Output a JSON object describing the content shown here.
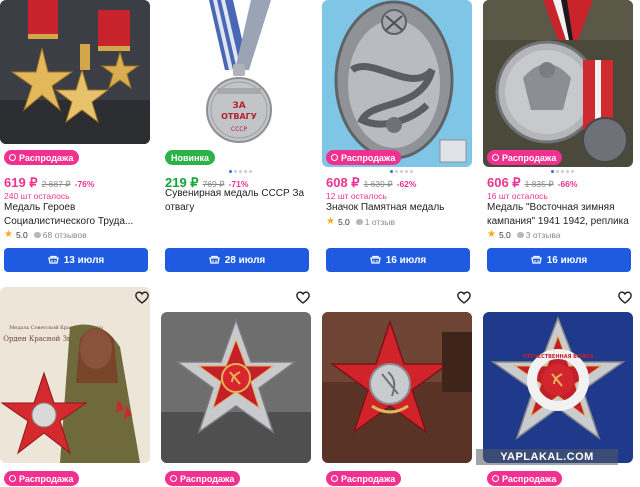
{
  "products": [
    {
      "badge": "Распродажа",
      "badge_type": "sale",
      "price": "619 ₽",
      "old_price": "2 687 ₽",
      "discount": "-76%",
      "stock": "240 шт осталось",
      "title": "Медаль Героев Социалистического Труда...",
      "rating": "5.0",
      "reviews": "68 отзывов",
      "delivery": "13 июля"
    },
    {
      "badge": "Новинка",
      "badge_type": "new",
      "price": "219 ₽",
      "old_price": "769 ₽",
      "discount": "-71%",
      "stock": "",
      "title": "Сувенирная медаль СССР За отвагу",
      "rating": "",
      "reviews": "",
      "delivery": "28 июля"
    },
    {
      "badge": "Распродажа",
      "badge_type": "sale",
      "price": "608 ₽",
      "old_price": "1 639 ₽",
      "discount": "-62%",
      "stock": "12 шт осталось",
      "title": "Значок Памятная медаль",
      "rating": "5.0",
      "reviews": "1 отзыв",
      "delivery": "16 июля"
    },
    {
      "badge": "Распродажа",
      "badge_type": "sale",
      "price": "606 ₽",
      "old_price": "1 835 ₽",
      "discount": "-66%",
      "stock": "16 шт осталось",
      "title": "Медаль \"Восточная зимняя кампания\" 1941 1942, реплика",
      "rating": "5.0",
      "reviews": "3 отзыва",
      "delivery": "16 июля"
    }
  ],
  "second_row": [
    {
      "badge": "Распродажа",
      "caption_top": "Медаль Советской Красной Звезды",
      "caption_bottom": "Орден Красной Звезды"
    },
    {
      "badge": "Распродажа"
    },
    {
      "badge": "Распродажа"
    },
    {
      "badge": "Распродажа",
      "ring_text": "ОТЕЧЕСТВЕННАЯ ВОЙНА"
    }
  ],
  "medal_texts": {
    "otvaga_line1": "ЗА",
    "otvaga_line2": "ОТВАГУ",
    "otvaga_line3": "СССР"
  },
  "watermark": "YAPLAKAL.COM",
  "colors": {
    "sale_badge": "#f0318f",
    "new_badge": "#2db24a",
    "delivery_button": "#1e5be0",
    "sale_price": "#f0318f",
    "new_price": "#13a538"
  },
  "icons": {
    "delivery": "truck-icon",
    "favorite": "heart-icon",
    "rating": "star-icon",
    "reviews": "speech-bubble-icon"
  }
}
